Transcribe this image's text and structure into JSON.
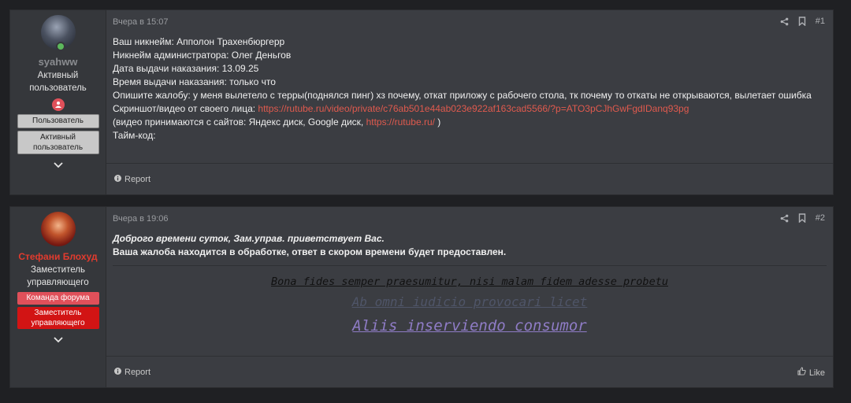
{
  "posts": [
    {
      "username": "syahww",
      "user_title": "Активный пользователь",
      "badges": [
        "Пользователь",
        "Активный пользователь"
      ],
      "date": "Вчера в 15:07",
      "number": "#1",
      "lines": [
        "Ваш никнейм: Апполон Трахенбюргерр",
        "Никнейм администратора: Олег Деньгов",
        "Дата выдачи наказания: 13.09.25",
        "Время выдачи наказания: только что",
        "Опишите жалобу: у меня вылетело с терры(поднялся пинг) хз почему, откат приложу с рабочего стола, тк почему то откаты не открываются, вылетает ошибка",
        "Скриншот/видео от своего лица: ",
        "https://rutube.ru/video/private/c76ab501e44ab023e922af163cad5566/?p=ATO3pCJhGwFgdIDanq93pg",
        "(видео принимаются с сайтов: Яндекс диск, Google диск, ",
        "https://rutube.ru/",
        " )",
        "Тайм-код:"
      ],
      "report_label": "Report"
    },
    {
      "username": "Стефани Блохуд",
      "user_title": "Заместитель управляющего",
      "badges": [
        "Команда форума",
        "Заместитель управляющего"
      ],
      "date": "Вчера в 19:06",
      "number": "#2",
      "greeting": "Доброго времени суток, Зам.управ. приветствует Вас.",
      "body": "Ваша жалоба находится в обработке, ответ в скором времени будет предоставлен.",
      "signature": [
        "Bona fides semper praesumitur, nisi malam fidem adesse probetu",
        "Ab omni iudicio provocari licet",
        "Aliis inserviendo consumor"
      ],
      "report_label": "Report",
      "like_label": "Like"
    }
  ],
  "colors": {
    "link": "#e05a4e",
    "staff_name": "#e23b2e",
    "badge_red": "#e0505a",
    "badge_deep_red": "#d21414"
  },
  "icons": [
    "share-icon",
    "bookmark-icon",
    "info-icon",
    "like-icon",
    "chevron-down-icon",
    "online-indicator-icon",
    "role-icon"
  ]
}
